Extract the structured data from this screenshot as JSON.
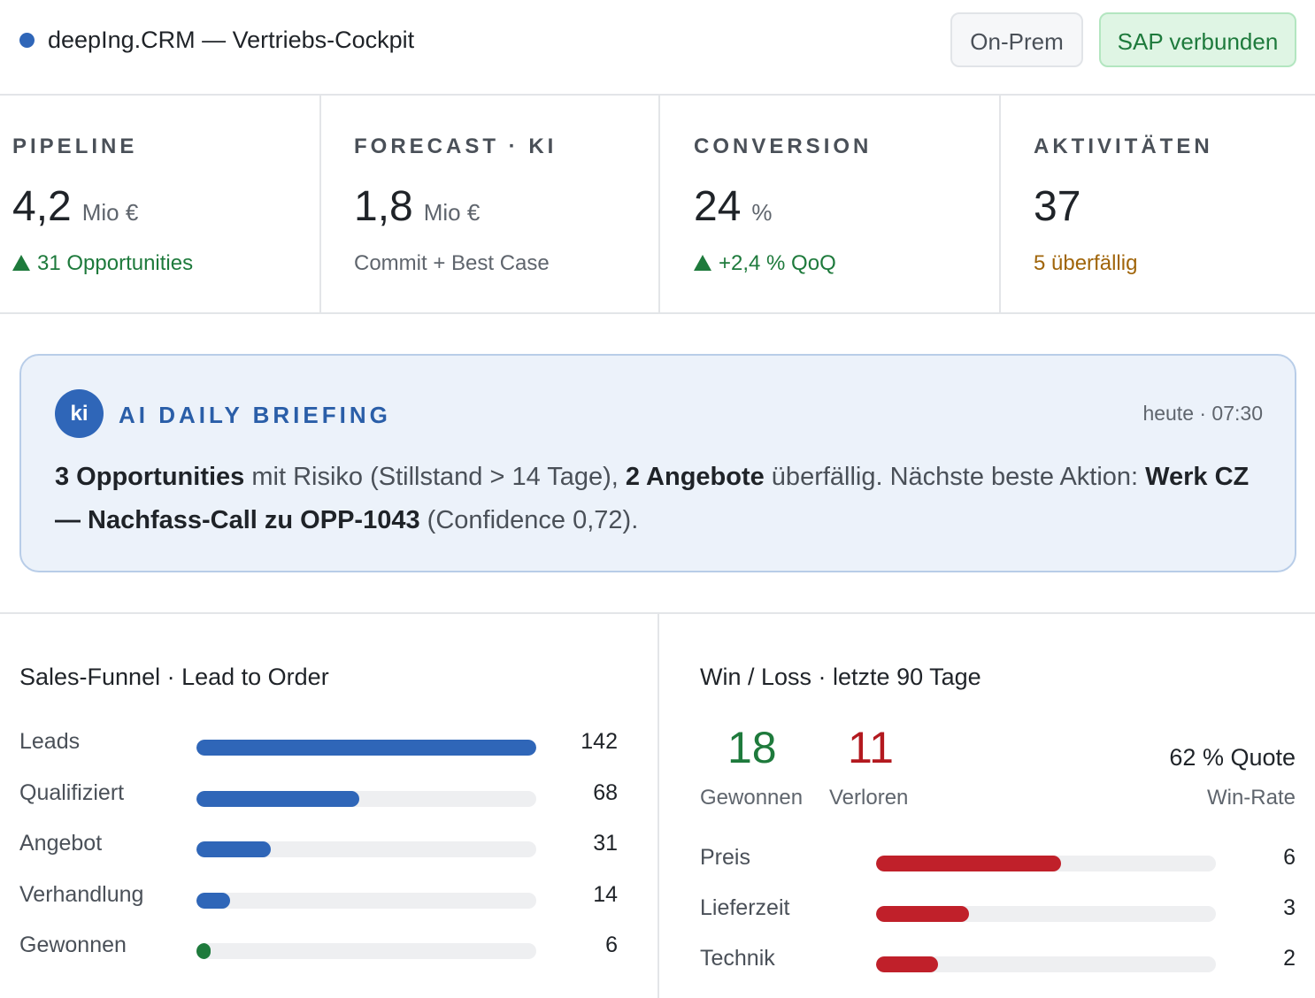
{
  "header": {
    "title": "deepIng.CRM — Vertriebs-Cockpit",
    "pills": {
      "onprem": "On-Prem",
      "sap": "SAP verbunden"
    }
  },
  "kpis": [
    {
      "label": "PIPELINE",
      "value": "4,2",
      "unit": "Mio €",
      "sub": "31 Opportunities",
      "sub_style": "up"
    },
    {
      "label": "FORECAST · KI",
      "value": "1,8",
      "unit": "Mio €",
      "sub": "Commit + Best Case",
      "sub_style": "muted"
    },
    {
      "label": "CONVERSION",
      "value": "24",
      "unit": "%",
      "sub": "+2,4 % QoQ",
      "sub_style": "up"
    },
    {
      "label": "AKTIVITÄTEN",
      "value": "37",
      "unit": "",
      "sub": "5 überfällig",
      "sub_style": "warn"
    }
  ],
  "briefing": {
    "badge": "ki",
    "title": "AI DAILY BRIEFING",
    "time": "heute · 07:30",
    "text": {
      "b1": "3 Opportunities",
      "t1": " mit Risiko (Stillstand > 14 Tage), ",
      "b2": "2 Angebote",
      "t2": " überfällig. Nächste beste Aktion: ",
      "b3": "Werk CZ — Nachfass-Call zu OPP-1043",
      "t3": " (Confidence 0,72)."
    }
  },
  "funnel": {
    "title": "Sales-Funnel · Lead to Order",
    "max": 142,
    "rows": [
      {
        "label": "Leads",
        "value": 142,
        "color": "#2f66b8"
      },
      {
        "label": "Qualifiziert",
        "value": 68,
        "color": "#2f66b8"
      },
      {
        "label": "Angebot",
        "value": 31,
        "color": "#2f66b8"
      },
      {
        "label": "Verhandlung",
        "value": 14,
        "color": "#2f66b8"
      },
      {
        "label": "Gewonnen",
        "value": 6,
        "color": "#1e7a3c"
      }
    ]
  },
  "winloss": {
    "title": "Win / Loss · letzte 90 Tage",
    "won": {
      "value": "18",
      "label": "Gewonnen",
      "color": "#1e7a3c"
    },
    "lost": {
      "value": "11",
      "label": "Verloren",
      "color": "#b3191f"
    },
    "quote": "62 % Quote",
    "quote_label": "Win-Rate",
    "max": 11,
    "reasons": [
      {
        "label": "Preis",
        "value": 6,
        "color": "#c0202a"
      },
      {
        "label": "Lieferzeit",
        "value": 3,
        "color": "#c0202a"
      },
      {
        "label": "Technik",
        "value": 2,
        "color": "#c0202a"
      }
    ]
  }
}
